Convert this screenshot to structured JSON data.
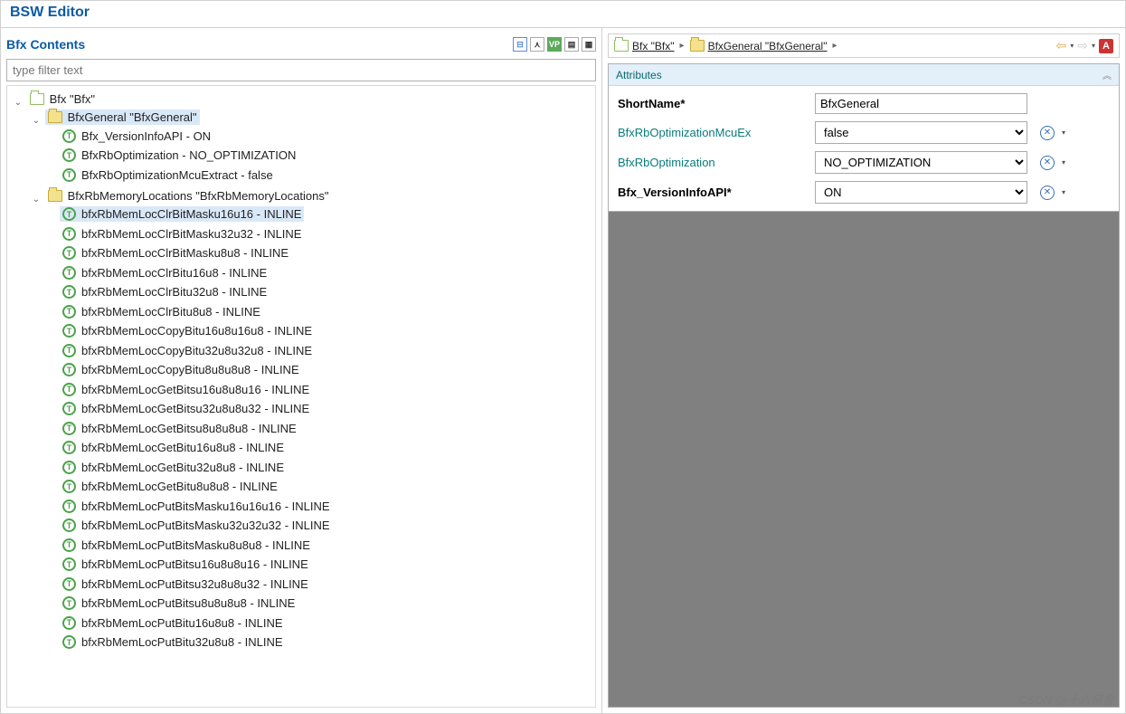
{
  "title": "BSW Editor",
  "left": {
    "header": "Bfx Contents",
    "filter_placeholder": "type filter text",
    "toolbar_icons": [
      "collapse-icon",
      "link-icon",
      "vp-icon",
      "doc-icon",
      "table-icon"
    ],
    "tree": {
      "root": "Bfx \"Bfx\"",
      "bfxgeneral": {
        "label": "BfxGeneral \"BfxGeneral\"",
        "children": [
          "Bfx_VersionInfoAPI - ON",
          "BfxRbOptimization - NO_OPTIMIZATION",
          "BfxRbOptimizationMcuExtract - false"
        ]
      },
      "memlocs": {
        "label": "BfxRbMemoryLocations \"BfxRbMemoryLocations\"",
        "children": [
          "bfxRbMemLocClrBitMasku16u16 - INLINE",
          "bfxRbMemLocClrBitMasku32u32 - INLINE",
          "bfxRbMemLocClrBitMasku8u8 - INLINE",
          "bfxRbMemLocClrBitu16u8 - INLINE",
          "bfxRbMemLocClrBitu32u8 - INLINE",
          "bfxRbMemLocClrBitu8u8 - INLINE",
          "bfxRbMemLocCopyBitu16u8u16u8 - INLINE",
          "bfxRbMemLocCopyBitu32u8u32u8 - INLINE",
          "bfxRbMemLocCopyBitu8u8u8u8 - INLINE",
          "bfxRbMemLocGetBitsu16u8u8u16 - INLINE",
          "bfxRbMemLocGetBitsu32u8u8u32 - INLINE",
          "bfxRbMemLocGetBitsu8u8u8u8 - INLINE",
          "bfxRbMemLocGetBitu16u8u8 - INLINE",
          "bfxRbMemLocGetBitu32u8u8 - INLINE",
          "bfxRbMemLocGetBitu8u8u8 - INLINE",
          "bfxRbMemLocPutBitsMasku16u16u16 - INLINE",
          "bfxRbMemLocPutBitsMasku32u32u32 - INLINE",
          "bfxRbMemLocPutBitsMasku8u8u8 - INLINE",
          "bfxRbMemLocPutBitsu16u8u8u16 - INLINE",
          "bfxRbMemLocPutBitsu32u8u8u32 - INLINE",
          "bfxRbMemLocPutBitsu8u8u8u8 - INLINE",
          "bfxRbMemLocPutBitu16u8u8 - INLINE",
          "bfxRbMemLocPutBitu32u8u8 - INLINE"
        ]
      },
      "selected_leaf_index": 0
    }
  },
  "right": {
    "breadcrumb": [
      {
        "icon": "folder",
        "label": "Bfx \"Bfx\""
      },
      {
        "icon": "folder-yellow",
        "label": "BfxGeneral \"BfxGeneral\""
      }
    ],
    "attributes_title": "Attributes",
    "attributes": [
      {
        "label": "ShortName*",
        "type": "text",
        "value": "BfxGeneral",
        "required": true
      },
      {
        "label": "BfxRbOptimizationMcuEx",
        "type": "select",
        "value": "false",
        "required": false
      },
      {
        "label": "BfxRbOptimization",
        "type": "select",
        "value": "NO_OPTIMIZATION",
        "required": false
      },
      {
        "label": "Bfx_VersionInfoAPI*",
        "type": "select",
        "value": "ON",
        "required": true
      }
    ]
  },
  "watermark": "CSDN @十六宿舍"
}
